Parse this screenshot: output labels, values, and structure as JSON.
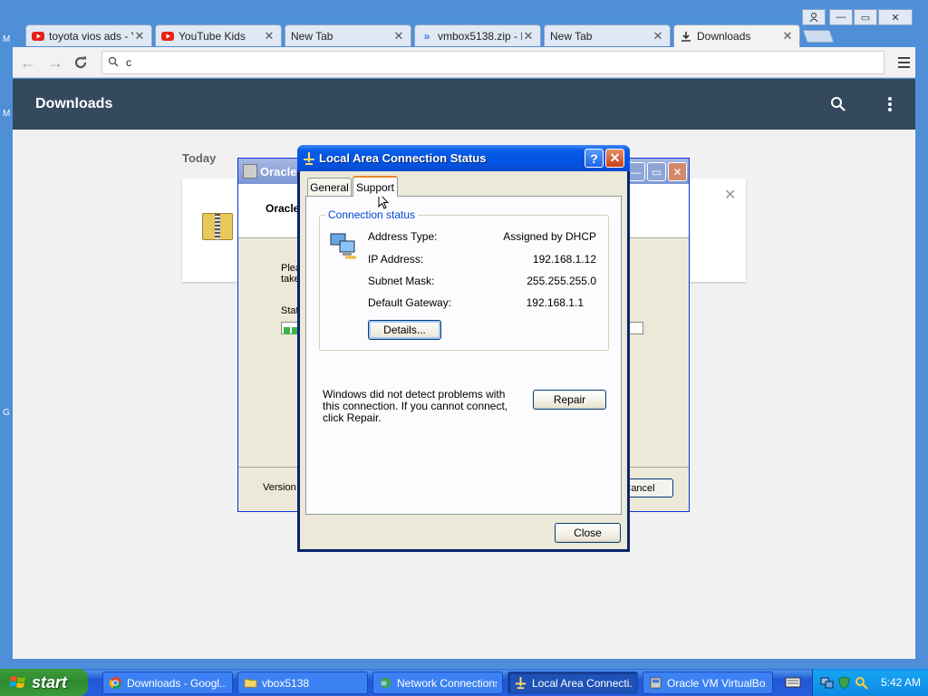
{
  "browser": {
    "tabs": [
      {
        "title": "toyota vios ads - Y",
        "favicon": "youtube-icon"
      },
      {
        "title": "YouTube Kids",
        "favicon": "youtube-icon"
      },
      {
        "title": "New Tab",
        "favicon": ""
      },
      {
        "title": "vmbox5138.zip - M",
        "favicon": "double-chevron-icon"
      },
      {
        "title": "New Tab",
        "favicon": ""
      },
      {
        "title": "Downloads",
        "favicon": "download-icon",
        "active": true
      }
    ],
    "omnibox_value": "c",
    "page": {
      "header_title": "Downloads",
      "section_label": "Today",
      "download_name": "Oracle"
    }
  },
  "vbox_installer": {
    "title": "Oracle",
    "heading": "Oracle",
    "please_wait_text": "Plea\ntake",
    "status_label": "Stat",
    "version_label": "Version",
    "cancel_label": "Cancel"
  },
  "dialog": {
    "title": "Local Area Connection Status",
    "tabs": [
      "General",
      "Support"
    ],
    "selected_tab": "Support",
    "group_label": "Connection status",
    "rows": [
      {
        "label": "Address Type:",
        "value": "Assigned by DHCP"
      },
      {
        "label": "IP Address:",
        "value": "192.168.1.12"
      },
      {
        "label": "Subnet Mask:",
        "value": "255.255.255.0"
      },
      {
        "label": "Default Gateway:",
        "value": "192.168.1.1"
      }
    ],
    "details_button": "Details...",
    "message": "Windows did not detect problems with this connection. If you cannot connect, click Repair.",
    "repair_button": "Repair",
    "close_button": "Close",
    "help_glyph": "?",
    "close_glyph": "✕"
  },
  "taskbar": {
    "start_label": "start",
    "items": [
      {
        "label": "Downloads - Googl...",
        "icon": "chrome-icon"
      },
      {
        "label": "vbox5138",
        "icon": "folder-icon"
      },
      {
        "label": "Network Connections",
        "icon": "network-icon"
      },
      {
        "label": "Local Area Connecti...",
        "icon": "lan-icon",
        "active": true
      },
      {
        "label": "Oracle VM VirtualBo...",
        "icon": "installer-icon"
      }
    ],
    "clock": "5:42 AM"
  },
  "colors": {
    "downloads_header": "#34495e",
    "xp_title_blue": "#0055e5",
    "start_green": "#2f8b2f"
  }
}
